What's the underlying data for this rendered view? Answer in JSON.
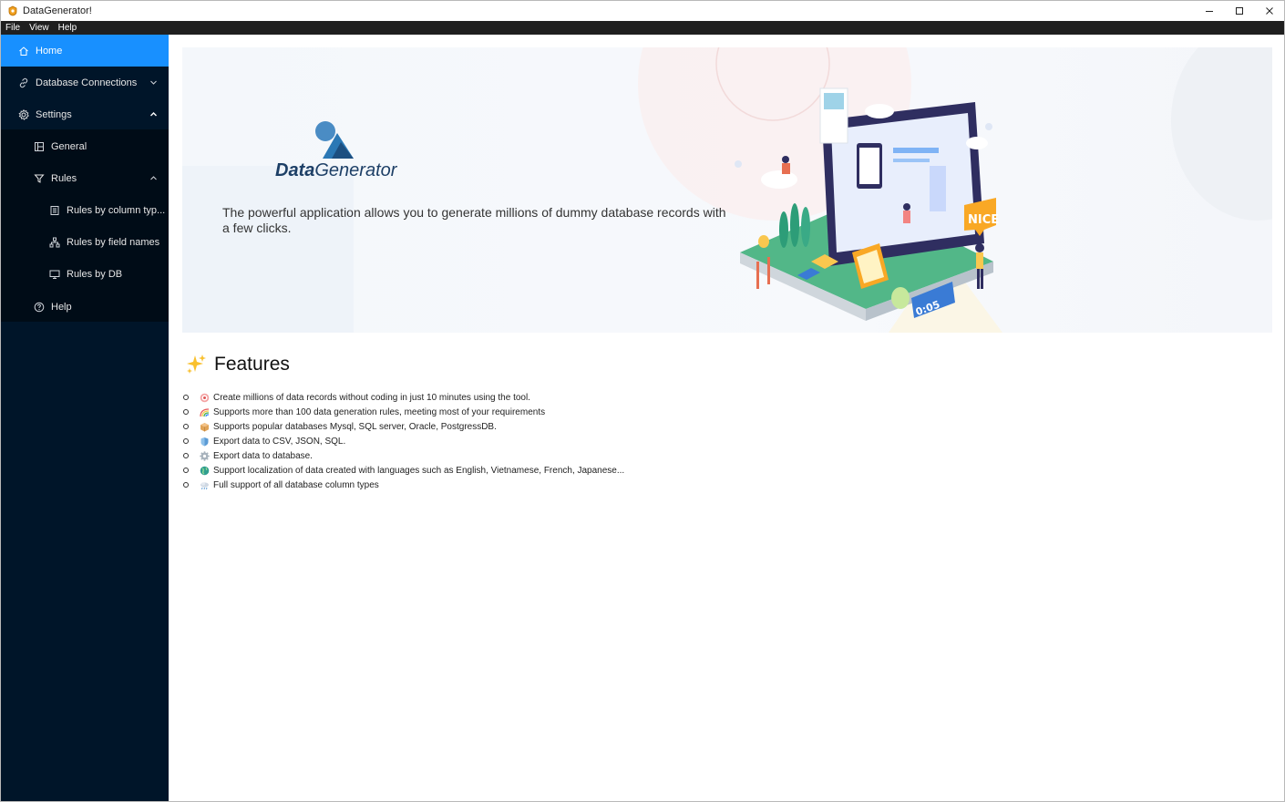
{
  "window": {
    "title": "DataGenerator!"
  },
  "menu": [
    "File",
    "View",
    "Help"
  ],
  "sidebar": {
    "items": [
      {
        "label": "Home",
        "icon": "home-icon",
        "active": true
      },
      {
        "label": "Database Connections",
        "icon": "link-icon",
        "chevron": "down"
      },
      {
        "label": "Settings",
        "icon": "gear-icon",
        "chevron": "up"
      },
      {
        "label": "General",
        "icon": "layout-icon"
      },
      {
        "label": "Rules",
        "icon": "filter-icon",
        "chevron": "up"
      },
      {
        "label": "Rules by column typ...",
        "icon": "list-icon"
      },
      {
        "label": "Rules by field names",
        "icon": "cluster-icon"
      },
      {
        "label": "Rules by DB",
        "icon": "monitor-icon"
      },
      {
        "label": "Help",
        "icon": "question-icon"
      }
    ]
  },
  "hero": {
    "logo_text_bold": "Data",
    "logo_text_light": "Generator",
    "description": "The powerful application allows you to generate millions of dummy database records with a few clicks.",
    "illustration_badge": "NICE",
    "illustration_clock": "0:05"
  },
  "features": {
    "title": "Features",
    "items": [
      {
        "text": "Create millions of data records without coding in just 10 minutes using the tool.",
        "icon": "target-icon"
      },
      {
        "text": "Supports more than 100 data generation rules, meeting most of your requirements",
        "icon": "rainbow-icon"
      },
      {
        "text": "Supports popular databases Mysql, SQL server, Oracle, PostgressDB.",
        "icon": "package-icon"
      },
      {
        "text": "Export data to CSV, JSON, SQL.",
        "icon": "shield-icon"
      },
      {
        "text": "Export data to database.",
        "icon": "gear-icon"
      },
      {
        "text": "Support localization of data created with languages such as English, Vietnamese, French, Japanese...",
        "icon": "globe-icon"
      },
      {
        "text": "Full support of all database column types",
        "icon": "cloud-icon"
      }
    ]
  },
  "colors": {
    "sidebar_bg": "#001529",
    "submenu_bg": "#000c17",
    "active_bg": "#1890ff",
    "brand_blue": "#2b78b5",
    "brand_dark": "#1d3f66"
  }
}
